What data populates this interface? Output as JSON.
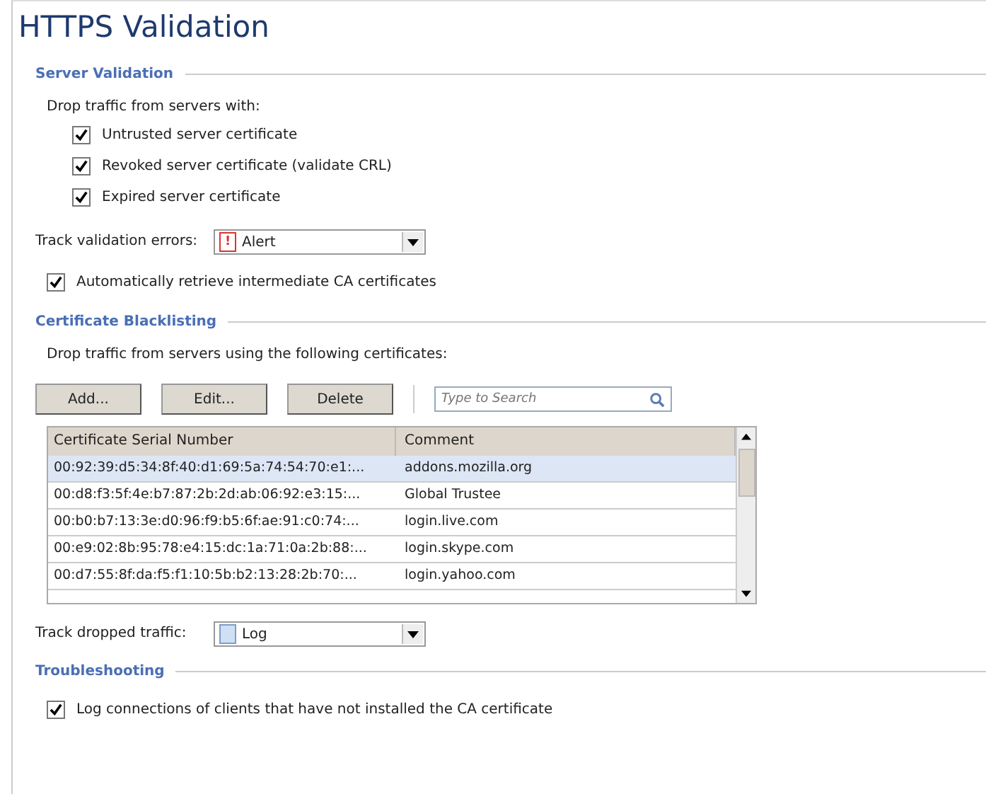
{
  "title": "HTTPS Validation",
  "server_validation": {
    "heading": "Server Validation",
    "intro": "Drop traffic from servers with:",
    "options": [
      {
        "label": "Untrusted server certificate",
        "checked": true
      },
      {
        "label": "Revoked server certificate (validate CRL)",
        "checked": true
      },
      {
        "label": "Expired server certificate",
        "checked": true
      }
    ],
    "track_label": "Track validation errors:",
    "track_value": "Alert",
    "track_icon": "!",
    "auto_retrieve": {
      "label": "Automatically retrieve intermediate CA certificates",
      "checked": true
    }
  },
  "blacklisting": {
    "heading": "Certificate Blacklisting",
    "intro": "Drop traffic from servers using the following certificates:",
    "buttons": [
      "Add...",
      "Edit...",
      "Delete"
    ],
    "search": {
      "placeholder": "Type to Search"
    },
    "columns": [
      "Certificate Serial Number",
      "Comment"
    ],
    "rows": [
      {
        "serial": "00:92:39:d5:34:8f:40:d1:69:5a:74:54:70:e1:...",
        "comment": "addons.mozilla.org",
        "selected": true
      },
      {
        "serial": "00:d8:f3:5f:4e:b7:87:2b:2d:ab:06:92:e3:15:...",
        "comment": "Global Trustee",
        "selected": false
      },
      {
        "serial": "00:b0:b7:13:3e:d0:96:f9:b5:6f:ae:91:c0:74:...",
        "comment": "login.live.com",
        "selected": false
      },
      {
        "serial": "00:e9:02:8b:95:78:e4:15:dc:1a:71:0a:2b:88:...",
        "comment": "login.skype.com",
        "selected": false
      },
      {
        "serial": "00:d7:55:8f:da:f5:f1:10:5b:b2:13:28:2b:70:...",
        "comment": "login.yahoo.com",
        "selected": false
      }
    ],
    "track_label": "Track dropped traffic:",
    "track_value": "Log"
  },
  "troubleshooting": {
    "heading": "Troubleshooting",
    "option": {
      "label": "Log connections of clients that have not installed the CA certificate",
      "checked": true
    }
  }
}
